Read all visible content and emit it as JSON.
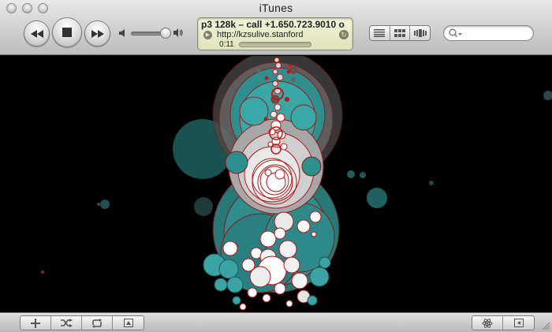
{
  "window": {
    "title": "iTunes"
  },
  "lcd": {
    "line1": "p3 128k – call +1.650.723.9010 o",
    "line2": "http://kzsulive.stanford",
    "elapsed": "0:11"
  },
  "search": {
    "placeholder": "",
    "value": ""
  },
  "icons": {
    "prev": "rewind-icon",
    "stop": "stop-icon",
    "next": "fast-forward-icon",
    "volume_low": "volume-low-icon",
    "volume_high": "volume-high-icon",
    "view_list": "list-view-icon",
    "view_grid": "grid-view-icon",
    "view_coverflow": "coverflow-view-icon",
    "add": "plus-icon",
    "shuffle": "shuffle-icon",
    "repeat": "repeat-icon",
    "artwork": "artwork-icon",
    "visualizer": "atom-icon",
    "browser": "browser-toggle-icon"
  },
  "colors": {
    "lcd_bg": "#e4e8c1",
    "viz_teal": "#3aa3a3",
    "viz_red": "#c8141e"
  }
}
